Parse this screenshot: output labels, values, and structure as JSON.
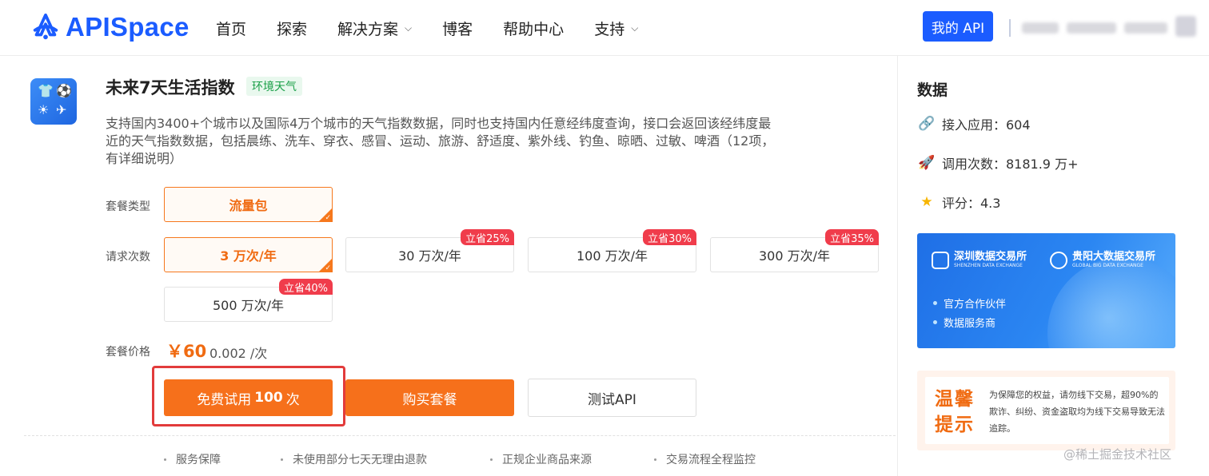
{
  "header": {
    "brand": "APISpace",
    "nav": [
      {
        "label": "首页",
        "has_dropdown": false
      },
      {
        "label": "探索",
        "has_dropdown": false
      },
      {
        "label": "解决方案",
        "has_dropdown": true
      },
      {
        "label": "博客",
        "has_dropdown": false
      },
      {
        "label": "帮助中心",
        "has_dropdown": false
      },
      {
        "label": "支持",
        "has_dropdown": true
      }
    ],
    "my_api_label": "我的 API",
    "accent_color": "#1b5cff"
  },
  "product": {
    "title": "未来7天生活指数",
    "tag": "环境天气",
    "description": "支持国内3400+个城市以及国际4万个城市的天气指数数据，同时也支持国内任意经纬度查询，接口会返回该经纬度最近的天气指数数据，包括晨练、洗车、穿衣、感冒、运动、旅游、舒适度、紫外线、钓鱼、晾晒、过敏、啤酒（12项，有详细说明）"
  },
  "package": {
    "type_label": "套餐类型",
    "type_option": "流量包",
    "count_label": "请求次数",
    "count_options": [
      {
        "label": "3 万次/年",
        "discount": "",
        "selected": true
      },
      {
        "label": "30 万次/年",
        "discount": "立省25%",
        "selected": false
      },
      {
        "label": "100 万次/年",
        "discount": "立省30%",
        "selected": false
      },
      {
        "label": "300 万次/年",
        "discount": "立省35%",
        "selected": false
      },
      {
        "label": "500 万次/年",
        "discount": "立省40%",
        "selected": false
      }
    ],
    "price_label": "套餐价格",
    "price": "￥60",
    "unit_price": "0.002 /次"
  },
  "actions": {
    "trial_prefix": "免费试用",
    "trial_count": "100",
    "trial_suffix": "次",
    "buy": "购买套餐",
    "test": "测试API"
  },
  "guarantees": [
    "服务保障",
    "未使用部分七天无理由退款",
    "正规企业商品来源",
    "交易流程全程监控"
  ],
  "side": {
    "title": "数据",
    "stats": [
      {
        "icon": "link-icon",
        "label": "接入应用：604"
      },
      {
        "icon": "rocket-icon",
        "label": "调用次数：8181.9 万+"
      },
      {
        "icon": "star-icon",
        "label": "评分：4.3"
      }
    ],
    "banner": {
      "org1_name": "深圳数据交易所",
      "org1_en": "SHENZHEN DATA EXCHANGE",
      "org2_name": "贵阳大数据交易所",
      "org2_en": "GLOBAL BIG DATA EXCHANGE",
      "lines": [
        "官方合作伙伴",
        "数据服务商"
      ]
    },
    "notice": {
      "title": "温馨提示",
      "text": "为保障您的权益，请勿线下交易，超90%的欺诈、纠纷、资金盗取均为线下交易导致无法追踪。"
    }
  },
  "watermark": "@稀土掘金技术社区"
}
